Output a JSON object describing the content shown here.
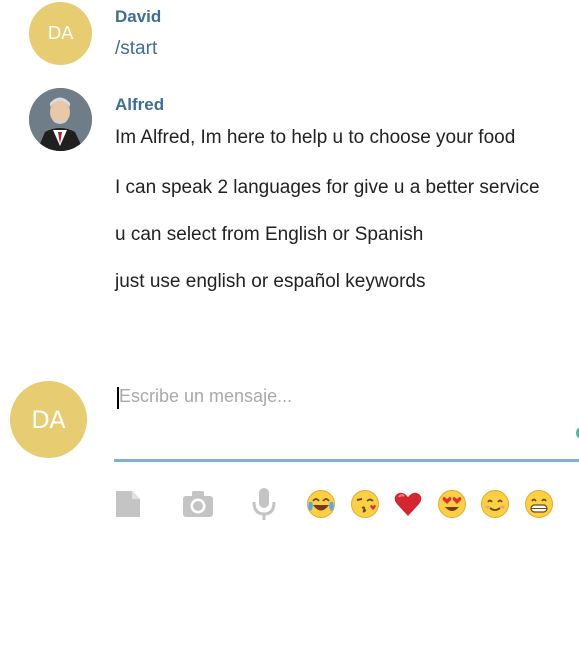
{
  "colors": {
    "accent": "#3f6d99",
    "avatar_bg": "#e8cc72",
    "input_underline": "#7fb1d4",
    "icon_gray": "#c4c4c4"
  },
  "messages": [
    {
      "sender": "David",
      "avatar_initials": "DA",
      "lines": [
        "/start"
      ]
    },
    {
      "sender": "Alfred",
      "avatar_icon": "butler-avatar-icon",
      "lines": [
        "Im Alfred, Im here to help u to choose  your food",
        "I can speak 2 languages for give u a better service",
        "u can select from English or Spanish",
        "just use english or español keywords"
      ]
    }
  ],
  "composer": {
    "avatar_initials": "DA",
    "placeholder": "Escribe un mensaje...",
    "tools": [
      "file-icon",
      "camera-icon",
      "microphone-icon"
    ],
    "emojis": [
      "face-with-tears-of-joy-icon",
      "face-blowing-kiss-icon",
      "red-heart-icon",
      "heart-eyes-icon",
      "smiling-face-icon",
      "grinning-face-icon"
    ]
  }
}
